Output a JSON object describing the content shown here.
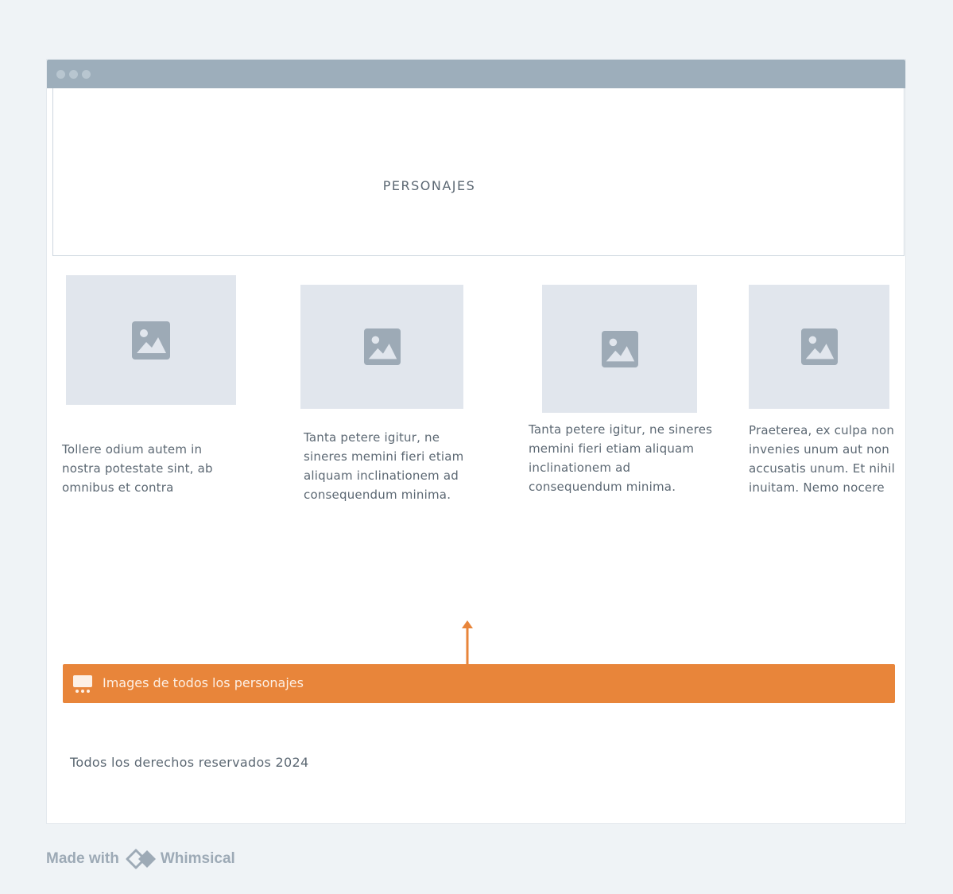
{
  "header": {
    "title": "PERSONAJES"
  },
  "cards": [
    {
      "image_icon": "image-placeholder-icon",
      "text": "Tollere odium autem in nostra potestate sint, ab omnibus et contra"
    },
    {
      "image_icon": "image-placeholder-icon",
      "text": "Tanta petere igitur, ne sineres memini fieri etiam aliquam inclinationem ad consequendum minima."
    },
    {
      "image_icon": "image-placeholder-icon",
      "text": "Tanta petere igitur, ne sineres memini fieri etiam aliquam inclinationem ad consequendum minima."
    },
    {
      "image_icon": "image-placeholder-icon",
      "text": "Praeterea, ex culpa non invenies unum aut non accusatis unum. Et nihil inuitam. Nemo nocere"
    }
  ],
  "annotation": {
    "icon": "slideshow-icon",
    "label": "Images de todos los personajes",
    "color": "#e8853a"
  },
  "footer": {
    "text": "Todos los derechos reservados 2024"
  },
  "branding": {
    "made_with": "Made with",
    "brand": "Whimsical"
  },
  "colors": {
    "background": "#eff3f6",
    "titlebar": "#9daebb",
    "placeholder": "#e1e6ed",
    "text": "#5c6873",
    "accent": "#e8853a"
  }
}
